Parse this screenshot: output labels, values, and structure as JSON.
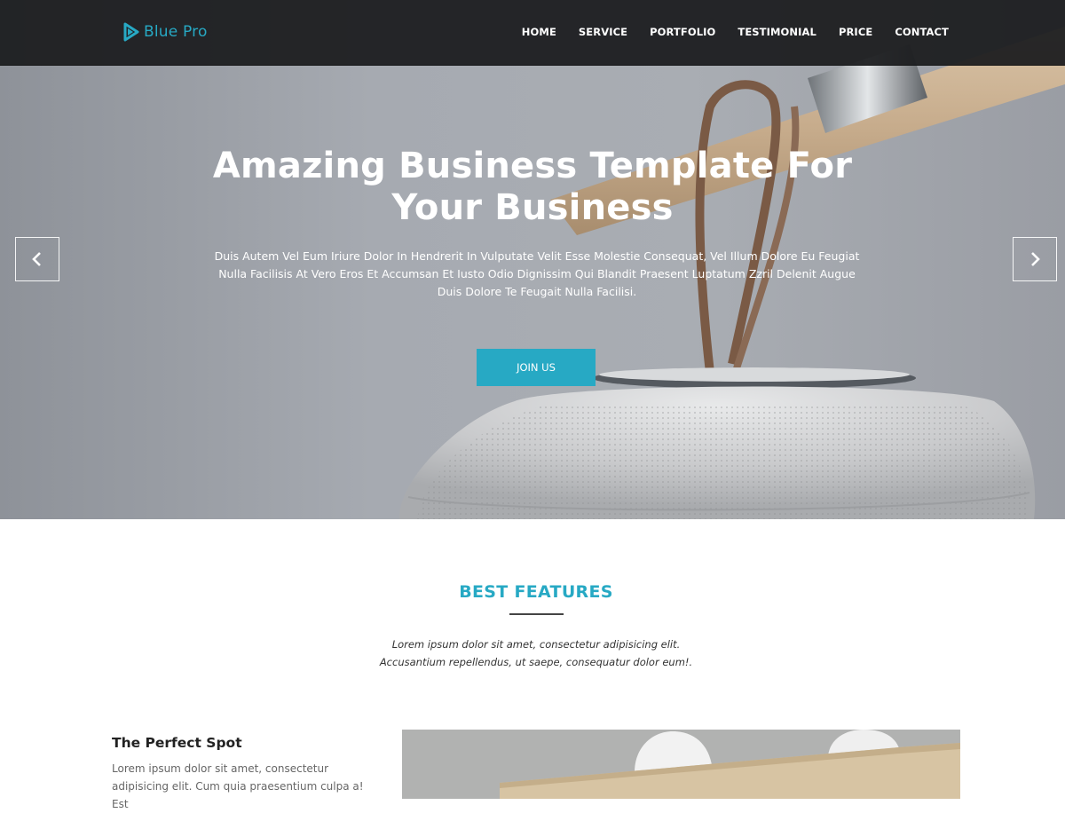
{
  "brand": {
    "name": "Blue Pro",
    "accent_color": "#27a9c4",
    "logo_icon": "play-triangle-icon"
  },
  "nav": {
    "items": [
      {
        "label": "HOME"
      },
      {
        "label": "SERVICE"
      },
      {
        "label": "PORTFOLIO"
      },
      {
        "label": "TESTIMONIAL"
      },
      {
        "label": "PRICE"
      },
      {
        "label": "CONTACT"
      }
    ]
  },
  "hero": {
    "title_line1": "Amazing Business Template For",
    "title_line2": "Your Business",
    "description": "Duis Autem Vel Eum Iriure Dolor In Hendrerit In Vulputate Velit Esse Molestie Consequat, Vel Illum Dolore Eu Feugiat Nulla Facilisis At Vero Eros Et Accumsan Et Iusto Odio Dignissim Qui Blandit Praesent Luptatum Zzril Delenit Augue Duis Dolore Te Feugait Nulla Facilisi.",
    "button_label": "JOIN US",
    "prev_icon": "chevron-left-icon",
    "next_icon": "chevron-right-icon"
  },
  "features": {
    "title": "BEST FEATURES",
    "subtitle_line1": "Lorem ipsum dolor sit amet, consectetur adipisicing elit.",
    "subtitle_line2": "Accusantium repellendus, ut saepe, consequatur dolor eum!.",
    "item": {
      "title": "The Perfect Spot",
      "text": "Lorem ipsum dolor sit amet, consectetur adipisicing elit. Cum quia praesentium culpa a! Est"
    }
  }
}
